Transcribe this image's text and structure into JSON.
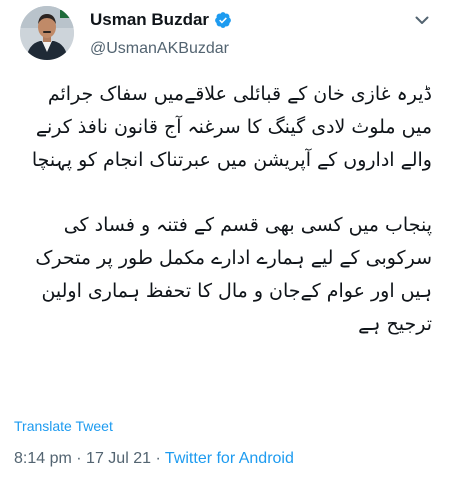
{
  "author": {
    "display_name": "Usman Buzdar",
    "handle": "@UsmanAKBuzdar",
    "verified": true,
    "avatar": "profile-photo"
  },
  "icons": {
    "verified": "verified-badge-icon",
    "more": "chevron-down-icon"
  },
  "tweet": {
    "paragraphs": [
      "ڈیرہ غازی خان کے قبائلی علاقےمیں سفاک جرائم میں ملوث لادی گینگ کا سرغنہ آج قانون نافذ کرنے والے اداروں کے آپریشن میں عبرتناک انجام کو پہنچا",
      "پنجاب میں کسی بھی قسم کے فتنہ و فساد کی سرکوبی کے لیے ہمارے ادارے مکمل طور پر متحرک ہیں اور عوام کےجان و مال کا تحفظ ہماری اولین ترجیح ہے"
    ],
    "translate_label": "Translate Tweet",
    "time": "8:14 pm",
    "separator": "·",
    "date": "17 Jul 21",
    "source": "Twitter for Android"
  },
  "colors": {
    "link": "#1d9bf0",
    "secondary_text": "#536471",
    "primary_text": "#0f1419"
  }
}
